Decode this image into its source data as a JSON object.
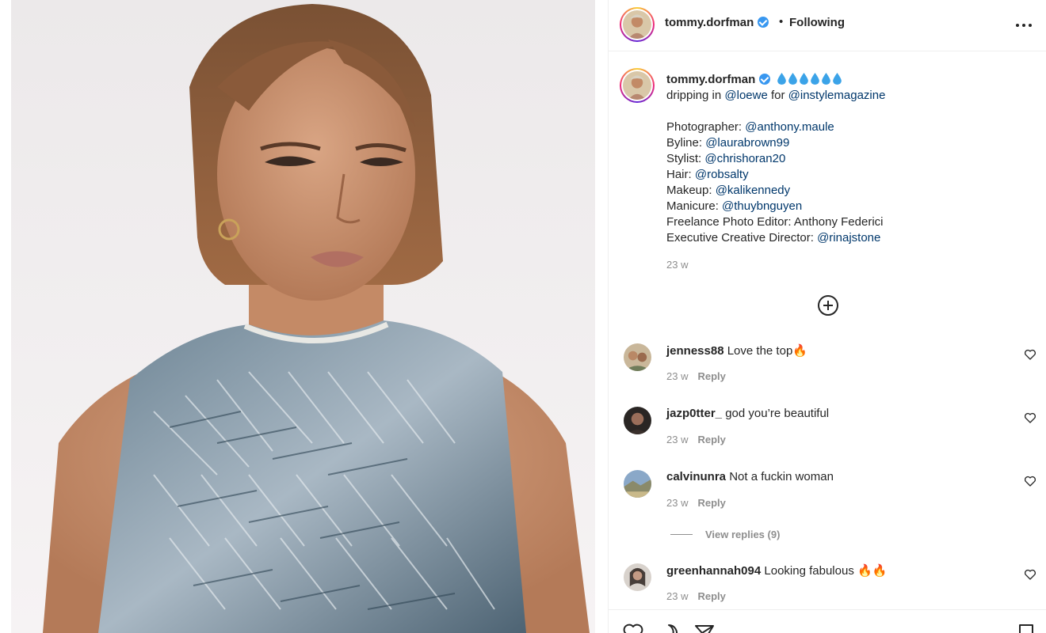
{
  "post": {
    "author": "tommy.dorfman",
    "header_separator": "•",
    "follow_status": "Following",
    "photo_alt": "Portrait of person in a fringed sequin top"
  },
  "caption": {
    "username": "tommy.dorfman",
    "lines": [
      {
        "prefix": "dripping in ",
        "mention": "@loewe",
        "mid": " for ",
        "mention2": "@instylemagazine"
      },
      {
        "prefix": "Photographer: ",
        "mention": "@anthony.maule"
      },
      {
        "prefix": "Byline: ",
        "mention": "@laurabrown99"
      },
      {
        "prefix": "Stylist: ",
        "mention": "@chrishoran20"
      },
      {
        "prefix": "Hair: ",
        "mention": "@robsalty"
      },
      {
        "prefix": "Makeup: ",
        "mention": "@kalikennedy"
      },
      {
        "prefix": "Manicure: ",
        "mention": "@thuybnguyen"
      },
      {
        "prefix": "Freelance Photo Editor: Anthony Federici"
      },
      {
        "prefix": "Executive Creative Director: ",
        "mention": "@rinajstone"
      }
    ],
    "time": "23 w"
  },
  "comments": [
    {
      "username": "jenness88",
      "text": "Love the top🔥",
      "time": "23 w",
      "reply_label": "Reply"
    },
    {
      "username": "jazp0tter_",
      "text": "god you’re beautiful",
      "time": "23 w",
      "reply_label": "Reply"
    },
    {
      "username": "calvinunra",
      "text": "Not a fuckin woman",
      "time": "23 w",
      "reply_label": "Reply"
    },
    {
      "username": "greenhannah094",
      "text": "Looking fabulous 🔥🔥",
      "time": "23 w",
      "reply_label": "Reply"
    }
  ],
  "view_replies": "View replies (9)",
  "colors": {
    "link": "#00376b",
    "secondary_text": "#8e8e8e",
    "verified": "#3897f0",
    "primary_text": "#262626"
  },
  "icons": [
    "verified-badge-icon",
    "more-options-icon",
    "add-comment-icon",
    "heart-icon",
    "comment-icon",
    "share-icon",
    "bookmark-icon"
  ]
}
